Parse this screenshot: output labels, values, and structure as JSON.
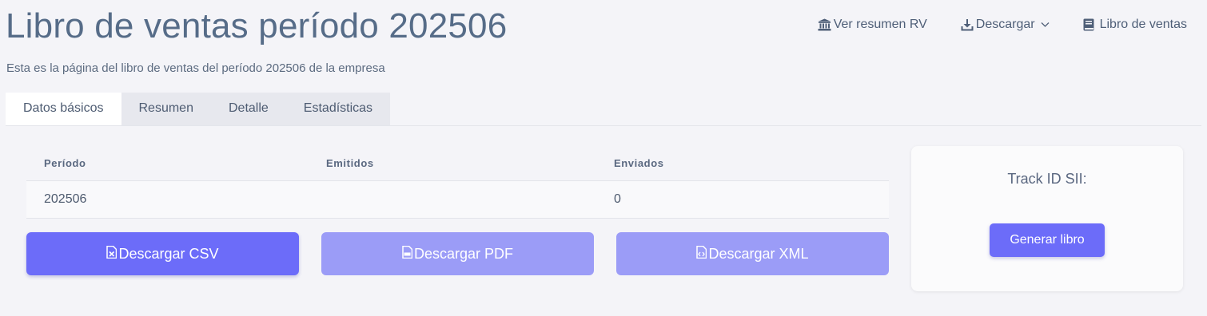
{
  "header": {
    "title": "Libro de ventas período 202506",
    "subtitle": "Esta es la página del libro de ventas del período 202506 de la empresa"
  },
  "actions": {
    "summary": {
      "label": "Ver resumen RV",
      "icon": "bank-icon"
    },
    "download": {
      "label": "Descargar",
      "icon": "download-icon"
    },
    "book": {
      "label": "Libro de ventas",
      "icon": "book-icon"
    }
  },
  "tabs": [
    {
      "label": "Datos básicos",
      "active": true
    },
    {
      "label": "Resumen"
    },
    {
      "label": "Detalle"
    },
    {
      "label": "Estadísticas"
    }
  ],
  "table": {
    "headers": [
      "Período",
      "Emitidos",
      "Enviados"
    ],
    "row": {
      "period": "202506",
      "emitted": "",
      "sent": "0"
    }
  },
  "buttons": {
    "csv": "Descargar CSV",
    "pdf": "Descargar PDF",
    "xml": "Descargar XML"
  },
  "card": {
    "track_label": "Track ID SII:",
    "generate_label": "Generar libro"
  },
  "colors": {
    "accent": "#6c6cf9",
    "accent_muted": "#9b9cf7",
    "title": "#566c88"
  }
}
